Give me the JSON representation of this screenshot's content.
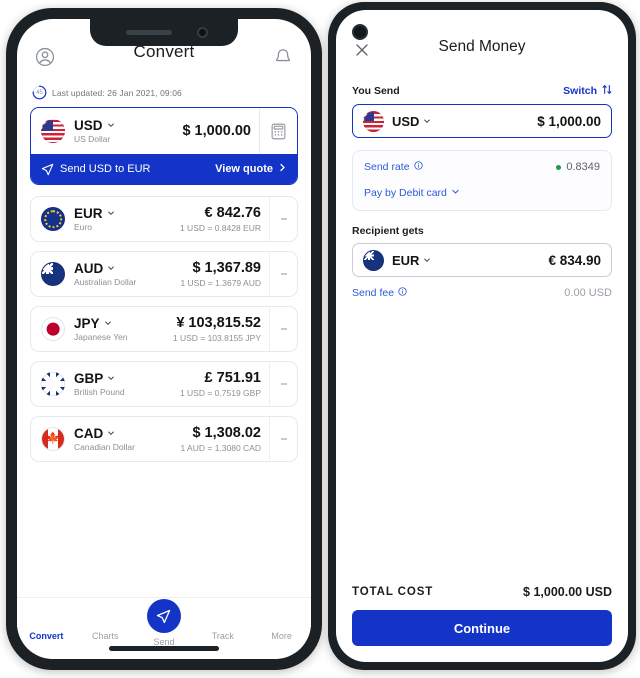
{
  "left_phone": {
    "header": {
      "title": "Convert",
      "profile_icon": "account-circle-icon",
      "bell_icon": "bell-icon"
    },
    "last_updated": {
      "countdown": "45",
      "text": "Last updated: 26 Jan 2021, 09:06"
    },
    "base_currency": {
      "code": "USD",
      "name": "US Dollar",
      "amount": "$ 1,000.00",
      "flag": "us-flag",
      "calculator_icon": "calculator-icon"
    },
    "cta": {
      "send_icon": "paper-plane-icon",
      "label": "Send USD to EUR",
      "quote_label": "View quote",
      "chevron_icon": "chevron-right-icon"
    },
    "currencies": [
      {
        "code": "EUR",
        "name": "Euro",
        "amount": "€ 842.76",
        "rate": "1 USD = 0.8428 EUR",
        "flag": "eu-flag"
      },
      {
        "code": "AUD",
        "name": "Australian Dollar",
        "amount": "$ 1,367.89",
        "rate": "1 USD = 1.3679 AUD",
        "flag": "au-flag"
      },
      {
        "code": "JPY",
        "name": "Japanese Yen",
        "amount": "¥ 103,815.52",
        "rate": "1 USD = 103.8155 JPY",
        "flag": "jp-flag"
      },
      {
        "code": "GBP",
        "name": "British Pound",
        "amount": "£ 751.91",
        "rate": "1 USD = 0.7519 GBP",
        "flag": "gb-flag"
      },
      {
        "code": "CAD",
        "name": "Canadian Dollar",
        "amount": "$ 1,308.02",
        "rate": "1 AUD = 1.3080 CAD",
        "flag": "ca-flag"
      }
    ],
    "tabbar": [
      {
        "label": "Convert",
        "icon": "coins-dollar-icon",
        "active": true
      },
      {
        "label": "Charts",
        "icon": "line-chart-icon",
        "active": false
      },
      {
        "label": "Send",
        "icon": "paper-plane-icon",
        "active": false
      },
      {
        "label": "Track",
        "icon": "map-pin-icon",
        "active": false
      },
      {
        "label": "More",
        "icon": "hamburger-icon",
        "active": false
      }
    ]
  },
  "right_phone": {
    "header": {
      "title": "Send Money",
      "close_icon": "close-icon"
    },
    "you_send": {
      "label": "You Send",
      "switch_label": "Switch",
      "switch_icon": "swap-vertical-icon",
      "code": "USD",
      "amount": "$ 1,000.00",
      "flag": "us-flag"
    },
    "rate_card": {
      "send_rate_label": "Send rate",
      "info_icon": "info-icon",
      "rate_value": "0.8349",
      "status_dot_color": "#1a9d3e",
      "pay_method_label": "Pay by Debit card",
      "chevron_icon": "chevron-down-icon"
    },
    "recipient": {
      "label": "Recipient gets",
      "code": "EUR",
      "amount": "€ 834.90",
      "flag": "au-flag"
    },
    "send_fee": {
      "label": "Send fee",
      "info_icon": "info-icon",
      "value": "0.00 USD"
    },
    "total": {
      "label": "TOTAL COST",
      "value": "$ 1,000.00 USD"
    },
    "continue_button": "Continue"
  },
  "colors": {
    "brand_blue": "#1434c8",
    "link_blue": "#2a5bd7",
    "status_green": "#1a9d3e",
    "muted_grey": "#8b8f98"
  }
}
